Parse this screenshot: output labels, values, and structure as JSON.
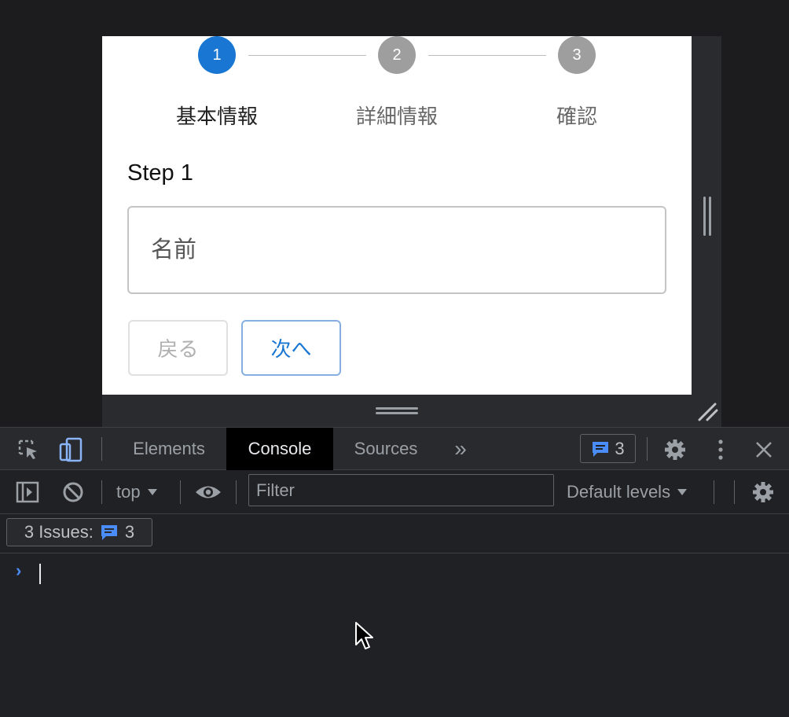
{
  "stepper": {
    "steps": [
      {
        "number": "1",
        "label": "基本情報",
        "state": "active"
      },
      {
        "number": "2",
        "label": "詳細情報",
        "state": "inactive"
      },
      {
        "number": "3",
        "label": "確認",
        "state": "inactive"
      }
    ]
  },
  "form": {
    "step_title": "Step 1",
    "name_placeholder": "名前",
    "name_value": "",
    "back_label": "戻る",
    "next_label": "次へ"
  },
  "devtools": {
    "tabs": [
      "Elements",
      "Console",
      "Sources"
    ],
    "active_tab": "Console",
    "more_tabs_glyph": "»",
    "issues_count": "3",
    "context": "top",
    "filter_placeholder": "Filter",
    "levels_label": "Default levels",
    "issues_label": "3 Issues:",
    "issues_badge_count": "3",
    "prompt_glyph": "›"
  },
  "colors": {
    "accent": "#1976d2",
    "inactive_step": "#9e9e9e",
    "devtools_bg": "#202124",
    "prompt": "#4b8df8"
  },
  "icons": [
    "inspect-element-icon",
    "device-toolbar-icon",
    "settings-gear-icon",
    "kebab-menu-icon",
    "close-icon",
    "sidebar-toggle-icon",
    "clear-console-icon",
    "eye-icon",
    "message-icon",
    "dropdown-arrow-icon",
    "mouse-cursor-icon"
  ]
}
